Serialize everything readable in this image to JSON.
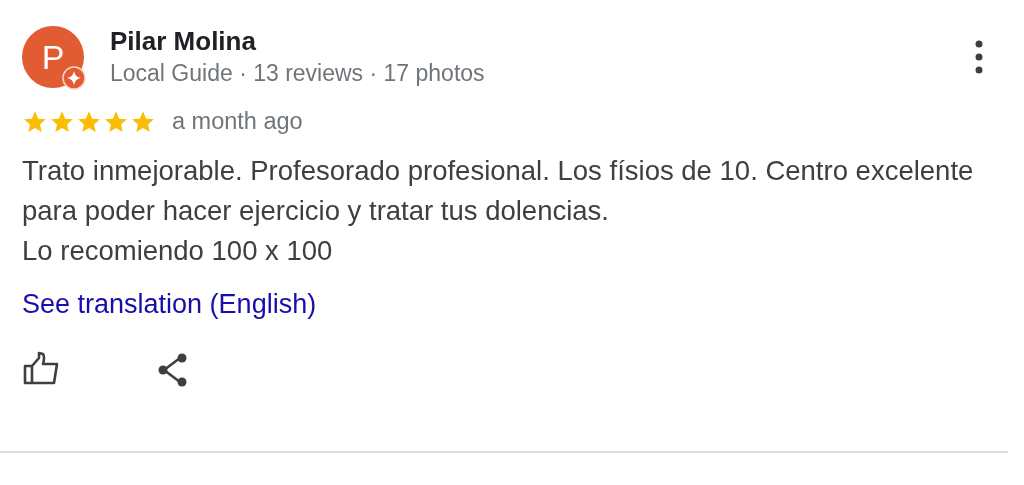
{
  "review": {
    "avatar_letter": "P",
    "author": "Pilar Molina",
    "local_guide_badge": true,
    "meta": "Local Guide · 13 reviews · 17 photos",
    "stars": 5,
    "time": "a month ago",
    "text_lines": [
      "Trato inmejorable. Profesorado profesional. Los físios de 10. Centro excelente",
      "para poder hacer ejercicio y tratar tus dolencias.",
      "Lo recomiendo 100 x 100"
    ],
    "translation_link": "See translation (English)"
  }
}
